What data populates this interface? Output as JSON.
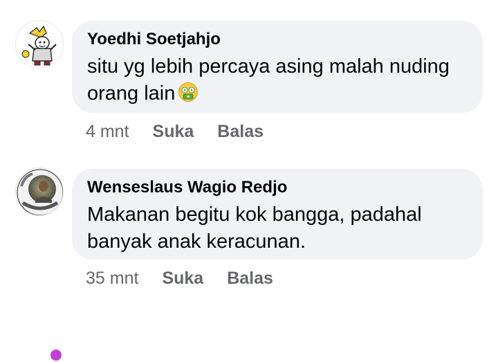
{
  "comments": [
    {
      "author": "Yoedhi Soetjahjo",
      "text": "situ yg lebih percaya asing malah nuding orang lain",
      "emoji": "money-mouth-face-icon",
      "time": "4 mnt",
      "like_label": "Suka",
      "reply_label": "Balas"
    },
    {
      "author": "Wenseslaus Wagio Redjo",
      "text": "Makanan begitu kok bangga, padahal banyak anak keracunan.",
      "time": "35 mnt",
      "like_label": "Suka",
      "reply_label": "Balas"
    }
  ],
  "colors": {
    "bubble_bg": "#f0f2f5",
    "meta_text": "#65676b",
    "primary_text": "#050505",
    "avatar_frame_accent": "#c23fd6"
  }
}
